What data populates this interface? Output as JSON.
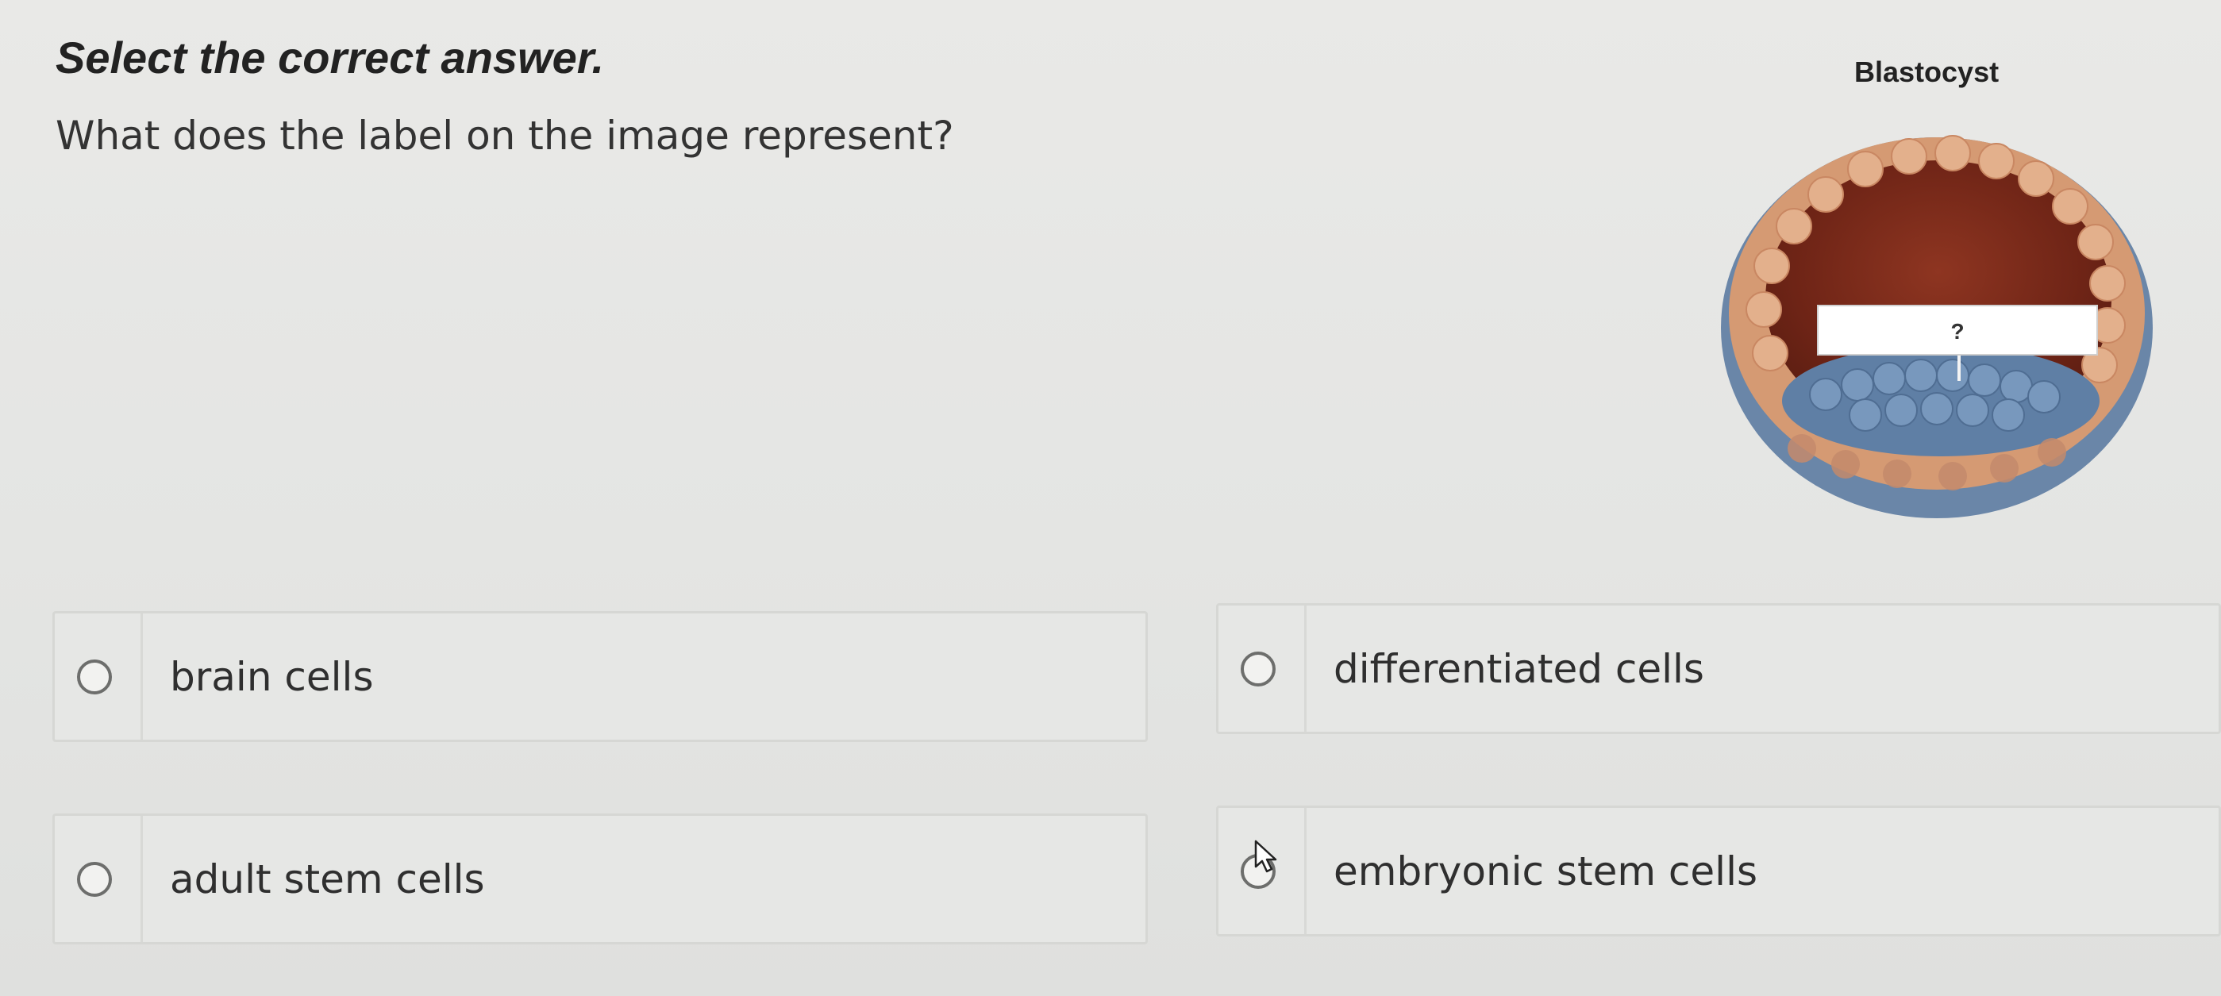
{
  "instruction": "Select the correct answer.",
  "question": "What does the label on the image represent?",
  "figure": {
    "title": "Blastocyst",
    "label_marker": "?"
  },
  "options": [
    {
      "label": "brain cells",
      "selected": false
    },
    {
      "label": "differentiated cells",
      "selected": false
    },
    {
      "label": "adult stem cells",
      "selected": false
    },
    {
      "label": "embryonic stem cells",
      "selected": false
    }
  ],
  "colors": {
    "trophoblast": "#d9a078",
    "cavity": "#7b2b1b",
    "inner_cell_mass": "#6b8cb0",
    "label_box": "#ffffff"
  }
}
